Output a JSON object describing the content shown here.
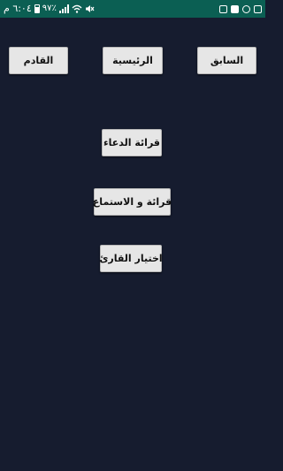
{
  "status_bar": {
    "time": "٦:٠٤ م",
    "battery_percent": "٩٧٪",
    "battery_level": 0.97
  },
  "nav": {
    "previous_label": "السابق",
    "home_label": "الرئيسية",
    "next_label": "القادم"
  },
  "menu": {
    "read_dua_label": "قرائة الدعاء",
    "read_listen_label": "قرائة و الاستماع",
    "choose_reciter_label": "اختيار القارئ"
  }
}
